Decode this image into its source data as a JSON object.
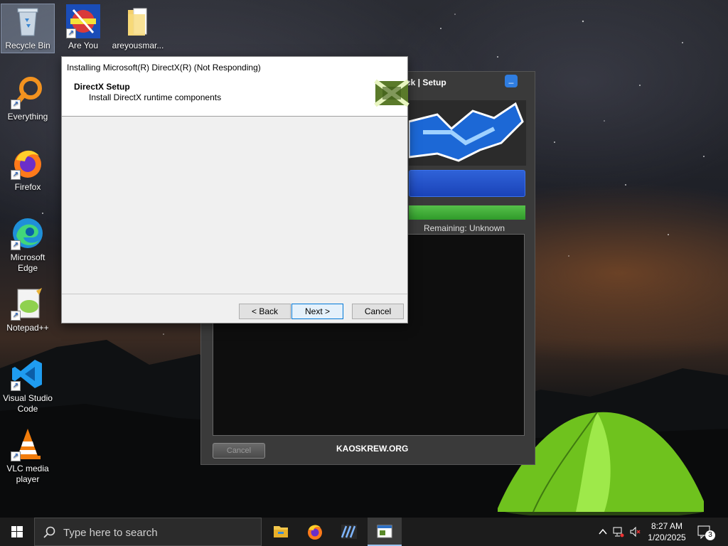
{
  "desktop": {
    "icons": [
      {
        "label": "Recycle Bin"
      },
      {
        "label": "Are You Smart?"
      },
      {
        "label": "areyousmar..."
      },
      {
        "label": "Everything"
      },
      {
        "label": "Firefox"
      },
      {
        "label": "Microsoft Edge"
      },
      {
        "label": "Notepad++"
      },
      {
        "label": "Visual Studio Code"
      },
      {
        "label": "VLC media player"
      }
    ]
  },
  "krew_window": {
    "title": "ck | Setup",
    "minimize": "_",
    "remaining": "Remaining: Unknown",
    "cancel": "Cancel",
    "site": "KAOSKREW.ORG"
  },
  "dx_window": {
    "title": "Installing Microsoft(R) DirectX(R) (Not Responding)",
    "header_title": "DirectX Setup",
    "header_subtitle": "Install DirectX runtime components",
    "back": "< Back",
    "next": "Next >",
    "cancel": "Cancel"
  },
  "taskbar": {
    "search_placeholder": "Type here to search",
    "time": "8:27 AM",
    "date": "1/20/2025",
    "notification_count": "3"
  },
  "colors": {
    "accent": "#0078d7",
    "taskbar": "#1c1c1c",
    "tent": "#7fd62a"
  }
}
